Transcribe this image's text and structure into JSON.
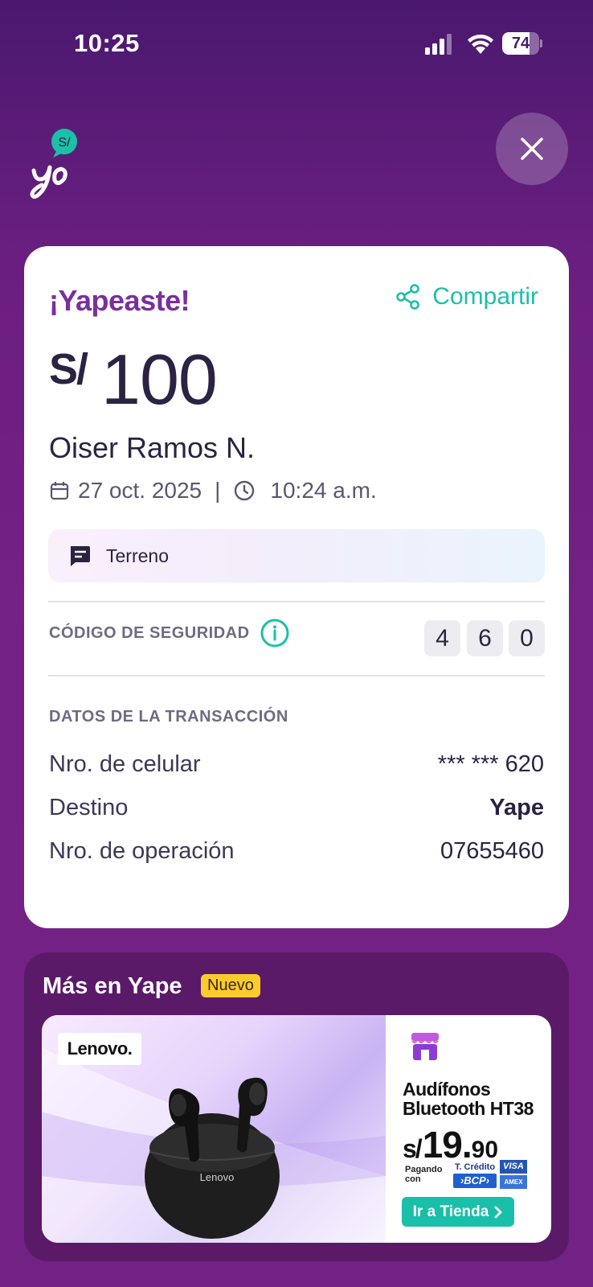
{
  "status_bar": {
    "time": "10:25",
    "battery": "74",
    "battery_level": 0.74
  },
  "header": {
    "logo_text": "S/ yo",
    "close_icon": "close-icon"
  },
  "receipt": {
    "title": "¡Yapeaste!",
    "share_label": "Compartir",
    "currency": "S/",
    "amount": "100",
    "recipient": "Oiser Ramos N.",
    "date": "27 oct. 2025",
    "separator": "|",
    "time": "10:24 a.m.",
    "note": "Terreno",
    "security_label": "CÓDIGO DE SEGURIDAD",
    "security_code": [
      "4",
      "6",
      "0"
    ],
    "transaction_title": "DATOS DE LA TRANSACCIÓN",
    "rows": [
      {
        "label": "Nro. de celular",
        "value": "*** *** 620"
      },
      {
        "label": "Destino",
        "value": "Yape"
      },
      {
        "label": "Nro. de operación",
        "value": "07655460"
      }
    ]
  },
  "promo": {
    "title": "Más en Yape",
    "badge": "Nuevo",
    "banner": {
      "brand": "Lenovo.",
      "case_label": "Lenovo",
      "product_line1": "Audífonos",
      "product_line2": "Bluetooth HT38",
      "price_currency": "s/",
      "price_integer": "19.",
      "price_decimal": "90",
      "pay_label_line1": "Pagando",
      "pay_label_line2": "con",
      "card_label": "T. Crédito",
      "bank": "›BCP›",
      "visa": "VISA",
      "amex": "AMEX",
      "cta": "Ir a Tienda"
    }
  },
  "colors": {
    "background": "#6a1f80",
    "accent": "#1cbfa8",
    "title": "#7a2f9c",
    "badge": "#fbcb2e"
  }
}
